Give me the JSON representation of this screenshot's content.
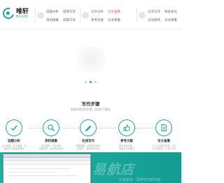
{
  "header": {
    "logo_cn": "唯轩",
    "logo_en": "BILUN",
    "nav_group1": [
      "选题分析",
      "资料搜集",
      "提纲写作",
      "初稿写作"
    ],
    "nav_group2": [
      "论文分析",
      "论文查重",
      "参考文献",
      "论文降重"
    ],
    "nav_group3": [
      "论文写作",
      "论文修改",
      "保会会员",
      "论文降重"
    ]
  },
  "hero": {
    "active_slide": 2,
    "slide_count": 3
  },
  "steps_section": {
    "title": "写作步骤",
    "subtitle": "根据本规范的步骤，完成如下建议",
    "steps": [
      {
        "icon": "check-icon",
        "title": "选题分析",
        "desc1": "针对选题，论文选题，见",
        "desc2": "解析行内的参考资料"
      },
      {
        "icon": "search-icon",
        "title": "资料搜集",
        "desc1": "资料搜索，专业资料",
        "desc2": "收集相关，最好的参考资"
      },
      {
        "icon": "pen-icon",
        "title": "在线写作",
        "desc1": "根据提纲，结构等不断写",
        "desc2": "在线写，参考资料内容"
      },
      {
        "icon": "thumb-up-icon",
        "title": "参考文献",
        "desc1": "参考文献列表，",
        "desc2": "准确引用的格式"
      },
      {
        "icon": "doc-icon",
        "title": "论文查重",
        "desc1": "10个主流查重系统，400",
        "desc2": "元文本查重，只需1分钟"
      }
    ]
  },
  "banner": {
    "watermark": "0101易航店",
    "watermark_sub": "行业论文 · 写作与分析平台"
  },
  "colors": {
    "accent": "#1aa89c",
    "active_nav": "#e2563f"
  }
}
